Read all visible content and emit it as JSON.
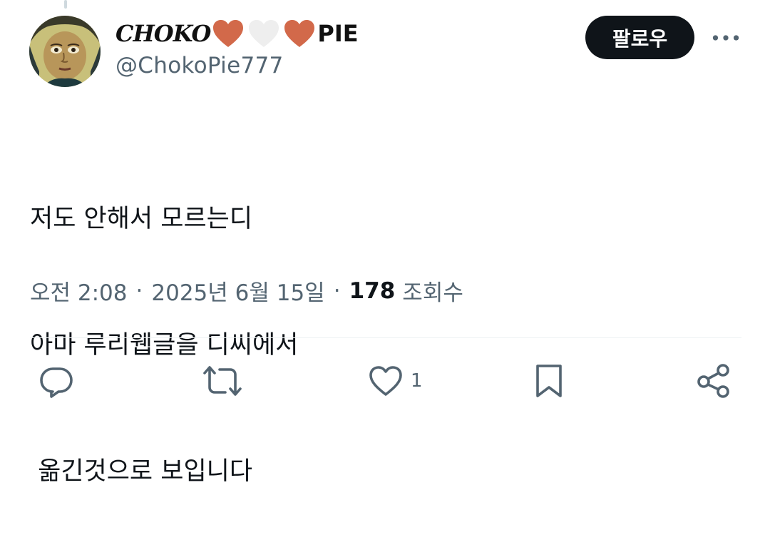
{
  "author": {
    "name_left": "CHOKO",
    "name_right": "PIE",
    "name_hearts": [
      "orange-heart",
      "white-heart",
      "orange-heart"
    ],
    "handle": "@ChokoPie777"
  },
  "follow_button": {
    "label": "팔로우"
  },
  "more_button": {
    "icon": "more-horizontal-icon"
  },
  "tweet": {
    "lines": [
      "저도 안해서 모르는디",
      "아마 루리웹글을 디씨에서",
      " 옮긴것으로 보입니다"
    ]
  },
  "meta": {
    "time": "오전 2:08",
    "separator": "·",
    "date": "2025년 6월 15일",
    "views_count": "178",
    "views_label": "조회수"
  },
  "actions": {
    "reply_icon": "reply-icon",
    "retweet_icon": "retweet-icon",
    "like_icon": "heart-icon",
    "like_count": "1",
    "bookmark_icon": "bookmark-icon",
    "share_icon": "share-icon"
  },
  "colors": {
    "text_primary": "#0f1419",
    "text_secondary": "#536471",
    "follow_bg": "#0f1419",
    "heart_orange": "#d2694a",
    "heart_white": "#eeeeee",
    "divider": "#eff3f4"
  }
}
